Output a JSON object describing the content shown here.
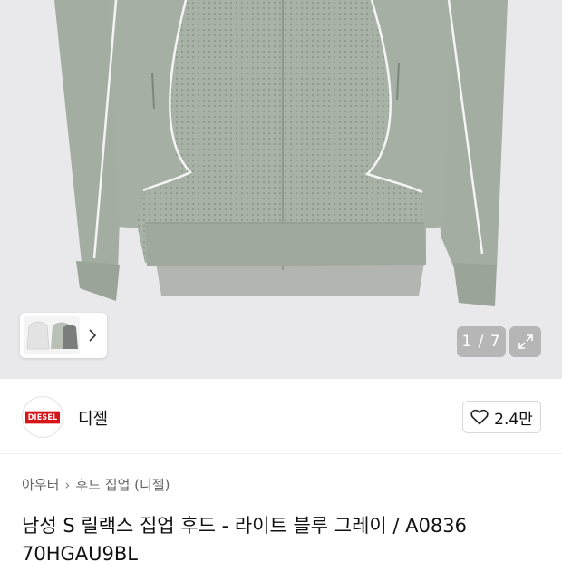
{
  "gallery": {
    "current": "1",
    "total": "7",
    "counter_text": "1 / 7"
  },
  "icons": {
    "thumbs_next": "chevron-right-icon",
    "expand": "expand-icon",
    "like": "heart-outline-icon"
  },
  "brand": {
    "logo_text": "DIESEL",
    "name": "디젤",
    "like_count": "2.4만",
    "logo_color": "#d7141a"
  },
  "breadcrumb": {
    "items": [
      "아우터",
      "후드 집업 (디젤)"
    ]
  },
  "product": {
    "title": "남성 S 릴랙스 집업 후드 - 라이트 블루 그레이 / A0836 70HGAU9BL"
  },
  "colors": {
    "image_background": "#e9e9eb",
    "jacket": "#a5b0a5",
    "accent_red": "#d7141a"
  }
}
